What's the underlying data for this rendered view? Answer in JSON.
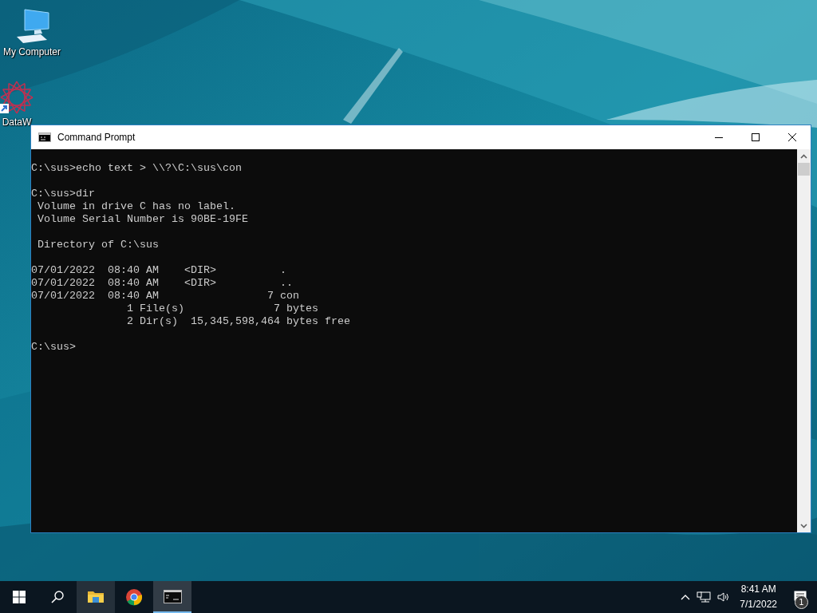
{
  "desktop_icons": [
    {
      "label": "My Computer",
      "kind": "computer"
    },
    {
      "label": "DataW",
      "kind": "shortcut"
    }
  ],
  "window": {
    "title": "Command Prompt",
    "console": {
      "blocks": [
        [
          "C:\\sus>echo text > \\\\?\\C:\\sus\\con"
        ],
        [
          "C:\\sus>dir",
          " Volume in drive C has no label.",
          " Volume Serial Number is 90BE-19FE"
        ],
        [
          " Directory of C:\\sus"
        ],
        [
          "07/01/2022  08:40 AM    <DIR>          .",
          "07/01/2022  08:40 AM    <DIR>          ..",
          "07/01/2022  08:40 AM                 7 con",
          "               1 File(s)              7 bytes",
          "               2 Dir(s)  15,345,598,464 bytes free"
        ],
        [
          "C:\\sus>"
        ]
      ]
    }
  },
  "taskbar": {
    "apps": [
      {
        "kind": "explorer",
        "selected": false,
        "hovered": true
      },
      {
        "kind": "chrome",
        "selected": false,
        "hovered": false
      },
      {
        "kind": "terminal",
        "selected": true,
        "hovered": false
      }
    ],
    "clock": {
      "time": "8:41 AM",
      "date": "7/1/2022"
    },
    "notifications": {
      "badge": "1"
    }
  }
}
